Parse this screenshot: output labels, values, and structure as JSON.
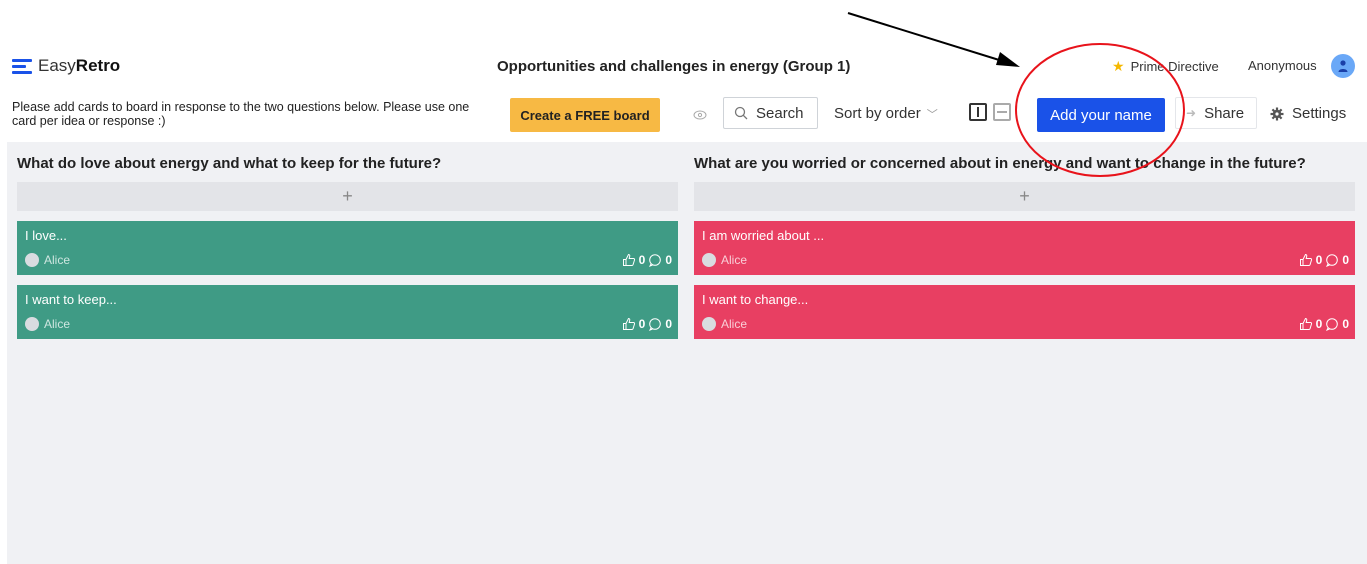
{
  "app": {
    "brand_a": "Easy",
    "brand_b": "Retro"
  },
  "header": {
    "board_title": "Opportunities and challenges in energy (Group 1)",
    "prime_directive": "Prime Directive",
    "user": "Anonymous"
  },
  "toolbar": {
    "instructions": "Please add cards to board in response to the two questions below. Please use one card per idea or response :)",
    "create_board": "Create a FREE board",
    "search": "Search",
    "sort": "Sort by order",
    "add_name": "Add your name",
    "share": "Share",
    "settings": "Settings"
  },
  "columns": [
    {
      "title": "What do love about energy and what to keep for the future?",
      "add": "+",
      "color": "#3f9b85",
      "cards": [
        {
          "text": "I love...",
          "author": "Alice",
          "likes": "0",
          "comments": "0"
        },
        {
          "text": "I want to keep...",
          "author": "Alice",
          "likes": "0",
          "comments": "0"
        }
      ]
    },
    {
      "title": "What are you worried or concerned about in energy and want to change in the future?",
      "add": "+",
      "color": "#e83f62",
      "cards": [
        {
          "text": "I am worried about ...",
          "author": "Alice",
          "likes": "0",
          "comments": "0"
        },
        {
          "text": "I want to change...",
          "author": "Alice",
          "likes": "0",
          "comments": "0"
        }
      ]
    }
  ],
  "colors": {
    "accent": "#1a52e8",
    "cta": "#f7b944",
    "annotation": "#e8131b"
  },
  "icons": [
    "logo-icon",
    "star-icon",
    "user-avatar-icon",
    "eye-icon",
    "search-icon",
    "chevron-down-icon",
    "columns-view-icon",
    "rows-view-icon",
    "share-icon",
    "gear-icon",
    "thumbs-up-icon",
    "comment-icon"
  ]
}
